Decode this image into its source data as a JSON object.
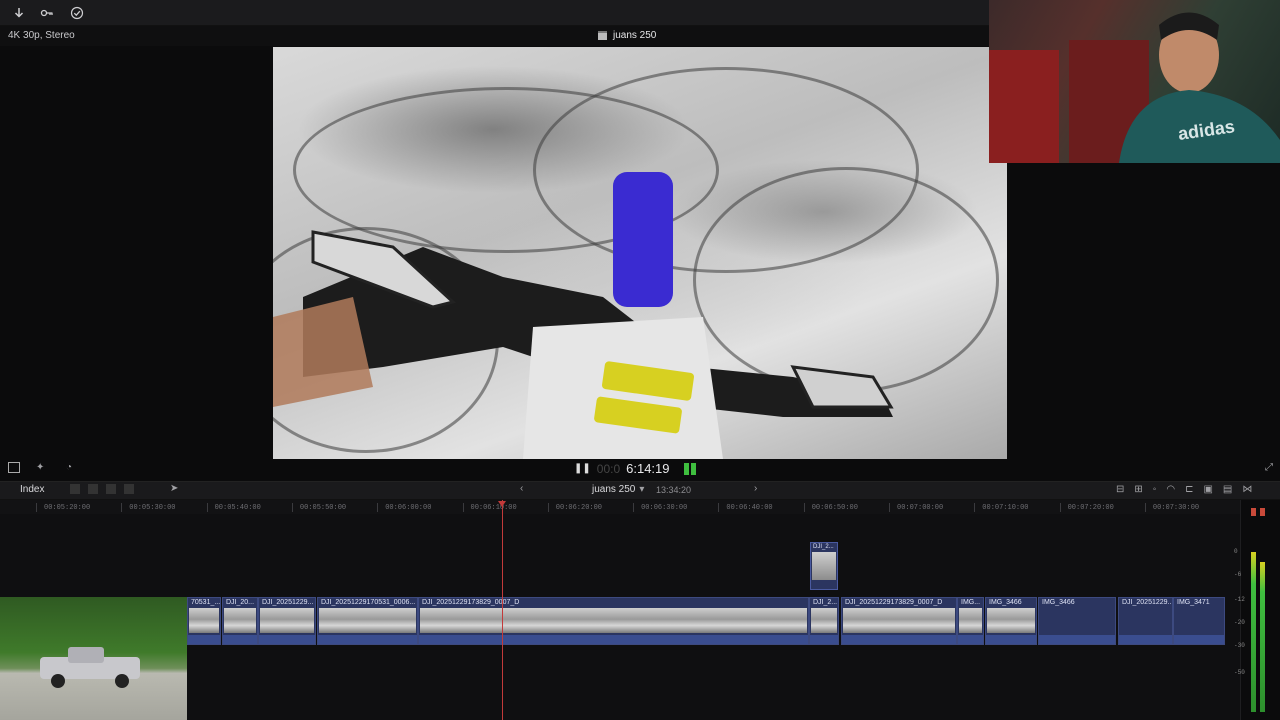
{
  "toolbar": {
    "buttons": [
      "import-icon",
      "keyword-icon",
      "checkmark-icon"
    ]
  },
  "viewer": {
    "format": "4K 30p, Stereo",
    "project_title": "juans 250"
  },
  "transport": {
    "timecode_faded": "00:0",
    "timecode": "6:14:19"
  },
  "timeline": {
    "index_label": "Index",
    "project_name": "juans 250",
    "duration": "13:34:20",
    "ruler_labels": [
      "00:05:20:00",
      "00:05:30:00",
      "00:05:40:00",
      "00:05:50:00",
      "00:06:00:00",
      "00:06:10:00",
      "00:06:20:00",
      "00:06:30:00",
      "00:06:40:00",
      "00:06:50:00",
      "00:07:00:00",
      "00:07:10:00",
      "00:07:20:00",
      "00:07:30:00"
    ],
    "connected_clip": "DJI_2...",
    "clips": [
      "70531_...",
      "DJI_20...",
      "DJI_20251229...",
      "DJI_20251229170531_0006...",
      "DJI_20251229173829_0007_D",
      "DJI_2...",
      "DJI_20251229173829_0007_D",
      "IMG...",
      "IMG_3466",
      "IMG_3466",
      "DJI_20251229...",
      "IMG_3471"
    ]
  },
  "meters": {
    "scale": [
      "0",
      "-6",
      "-12",
      "-20",
      "-30",
      "-50"
    ]
  },
  "colors": {
    "accent_playhead": "#c23a3a",
    "clip_blue": "#2b3560",
    "audio_blue": "#3a4d8f",
    "meter_green": "#3fbf3f"
  }
}
